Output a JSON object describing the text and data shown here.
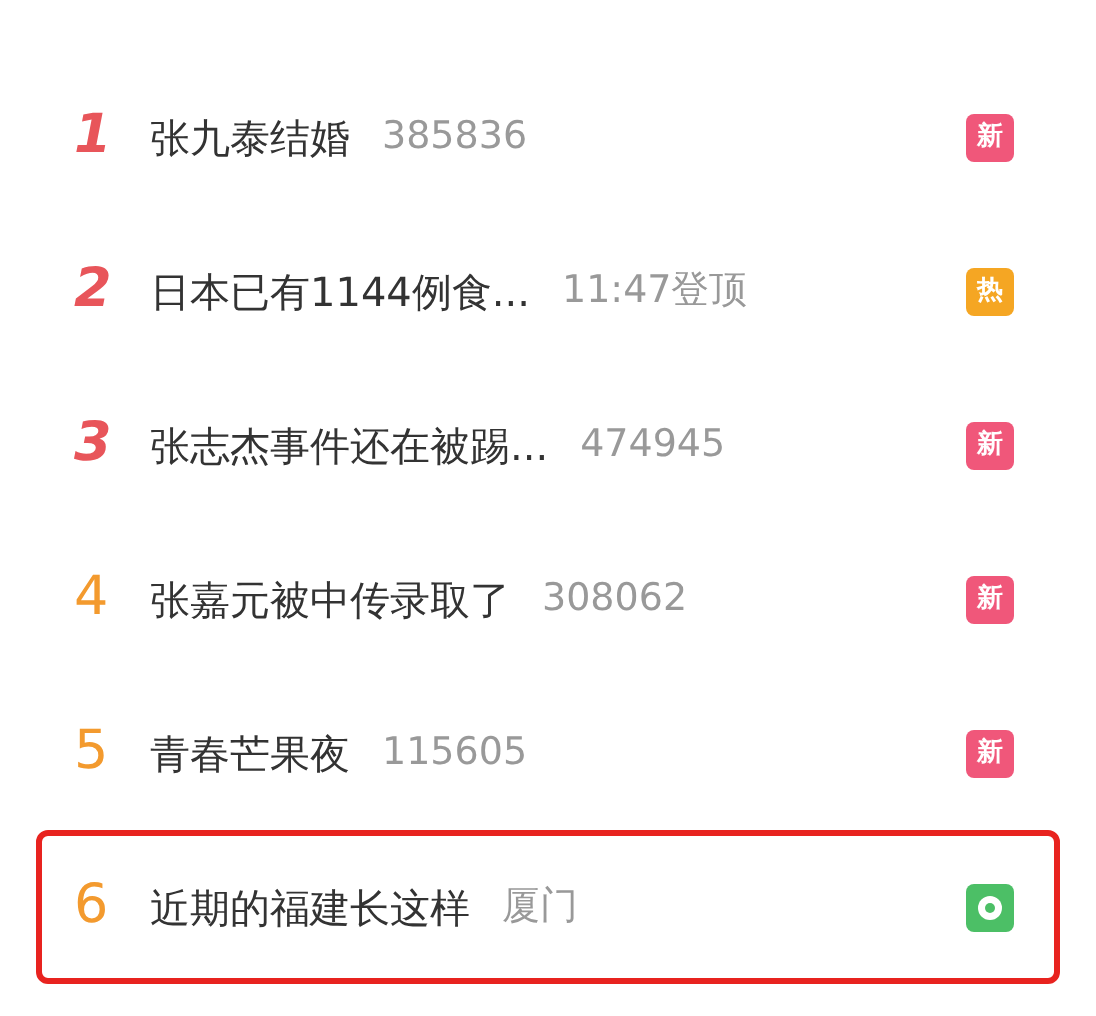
{
  "items": [
    {
      "rank": "1",
      "color": "#e8555a",
      "top": true,
      "title": "张九泰结婚",
      "meta": "385836",
      "badge": {
        "kind": "text",
        "text": "新",
        "color": "#f0577a"
      },
      "selected": false
    },
    {
      "rank": "2",
      "color": "#e8555a",
      "top": true,
      "title": "日本已有1144例食...",
      "meta": "11:47登顶",
      "badge": {
        "kind": "text",
        "text": "热",
        "color": "#f5a623"
      },
      "selected": false
    },
    {
      "rank": "3",
      "color": "#e8555a",
      "top": true,
      "title": "张志杰事件还在被踢...",
      "meta": "474945",
      "badge": {
        "kind": "text",
        "text": "新",
        "color": "#f0577a"
      },
      "selected": false
    },
    {
      "rank": "4",
      "color": "#f39a2e",
      "top": false,
      "title": "张嘉元被中传录取了",
      "meta": "308062",
      "badge": {
        "kind": "text",
        "text": "新",
        "color": "#f0577a"
      },
      "selected": false
    },
    {
      "rank": "5",
      "color": "#f39a2e",
      "top": false,
      "title": "青春芒果夜",
      "meta": "115605",
      "badge": {
        "kind": "text",
        "text": "新",
        "color": "#f0577a"
      },
      "selected": false
    },
    {
      "rank": "6",
      "color": "#f39a2e",
      "top": false,
      "title": "近期的福建长这样",
      "meta": "厦门",
      "badge": {
        "kind": "location",
        "color": "#4cbf66"
      },
      "selected": true
    }
  ]
}
